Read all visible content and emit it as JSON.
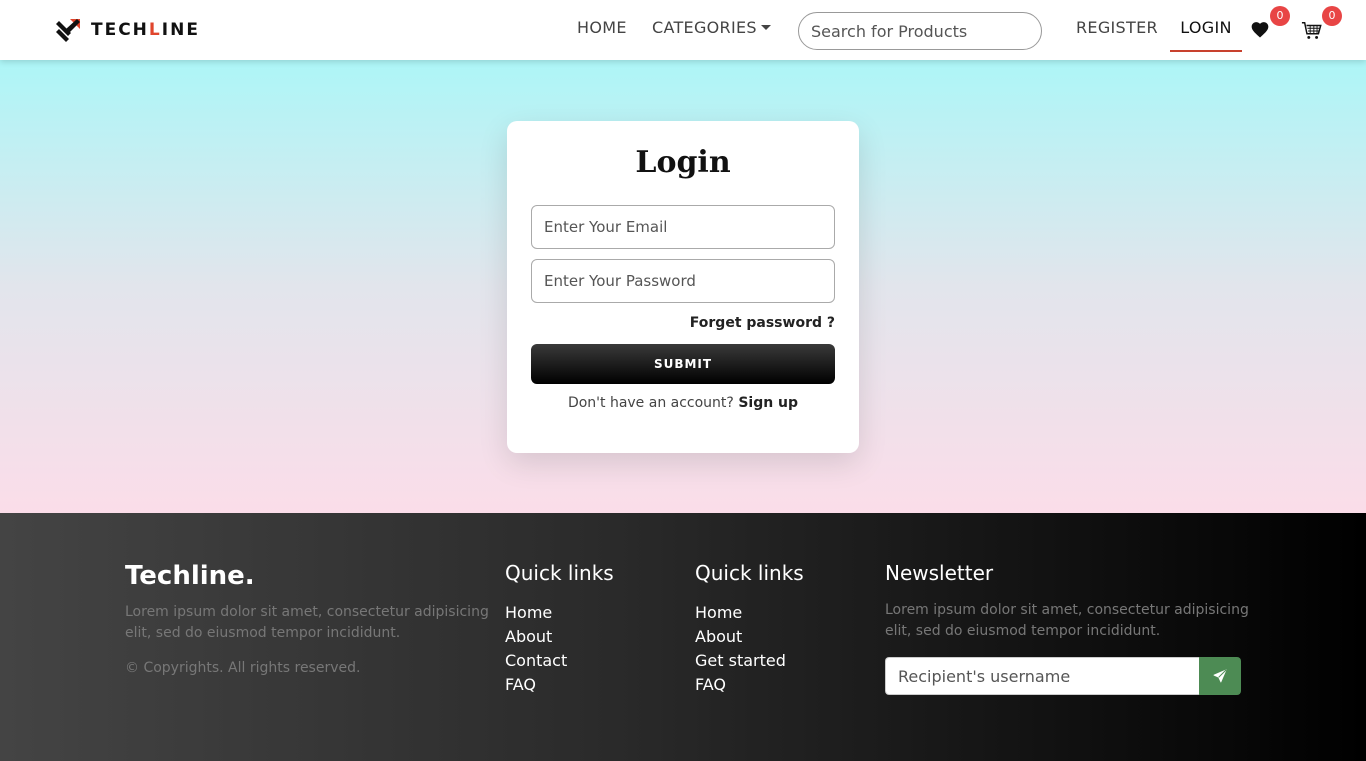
{
  "brand": {
    "logo_prefix": "TECH",
    "logo_accent": "L",
    "logo_suffix": "INE",
    "accent_color": "#e0452d"
  },
  "nav": {
    "home": "HOME",
    "categories": "CATEGORIES",
    "search_placeholder": "Search for Products",
    "register": "REGISTER",
    "login": "LOGIN",
    "wishlist_count": "0",
    "cart_count": "0"
  },
  "login_form": {
    "title": "Login",
    "email_placeholder": "Enter Your Email",
    "password_placeholder": "Enter Your Password",
    "forgot": "Forget password ?",
    "submit": "SUBMIT",
    "signup_prompt": "Don't have an account?",
    "signup_link": "Sign up"
  },
  "footer": {
    "brand": "Techline.",
    "brand_desc": "Lorem ipsum dolor sit amet, consectetur adipisicing elit, sed do eiusmod tempor incididunt.",
    "copyright": "© Copyrights. All rights reserved.",
    "col1": {
      "title": "Quick links",
      "links": [
        "Home",
        "About",
        "Contact",
        "FAQ"
      ]
    },
    "col2": {
      "title": "Quick links",
      "links": [
        "Home",
        "About",
        "Get started",
        "FAQ"
      ]
    },
    "newsletter": {
      "title": "Newsletter",
      "desc": "Lorem ipsum dolor sit amet, consectetur adipisicing elit, sed do eiusmod tempor incididunt.",
      "placeholder": "Recipient's username",
      "button_color": "#4d8b54"
    }
  }
}
